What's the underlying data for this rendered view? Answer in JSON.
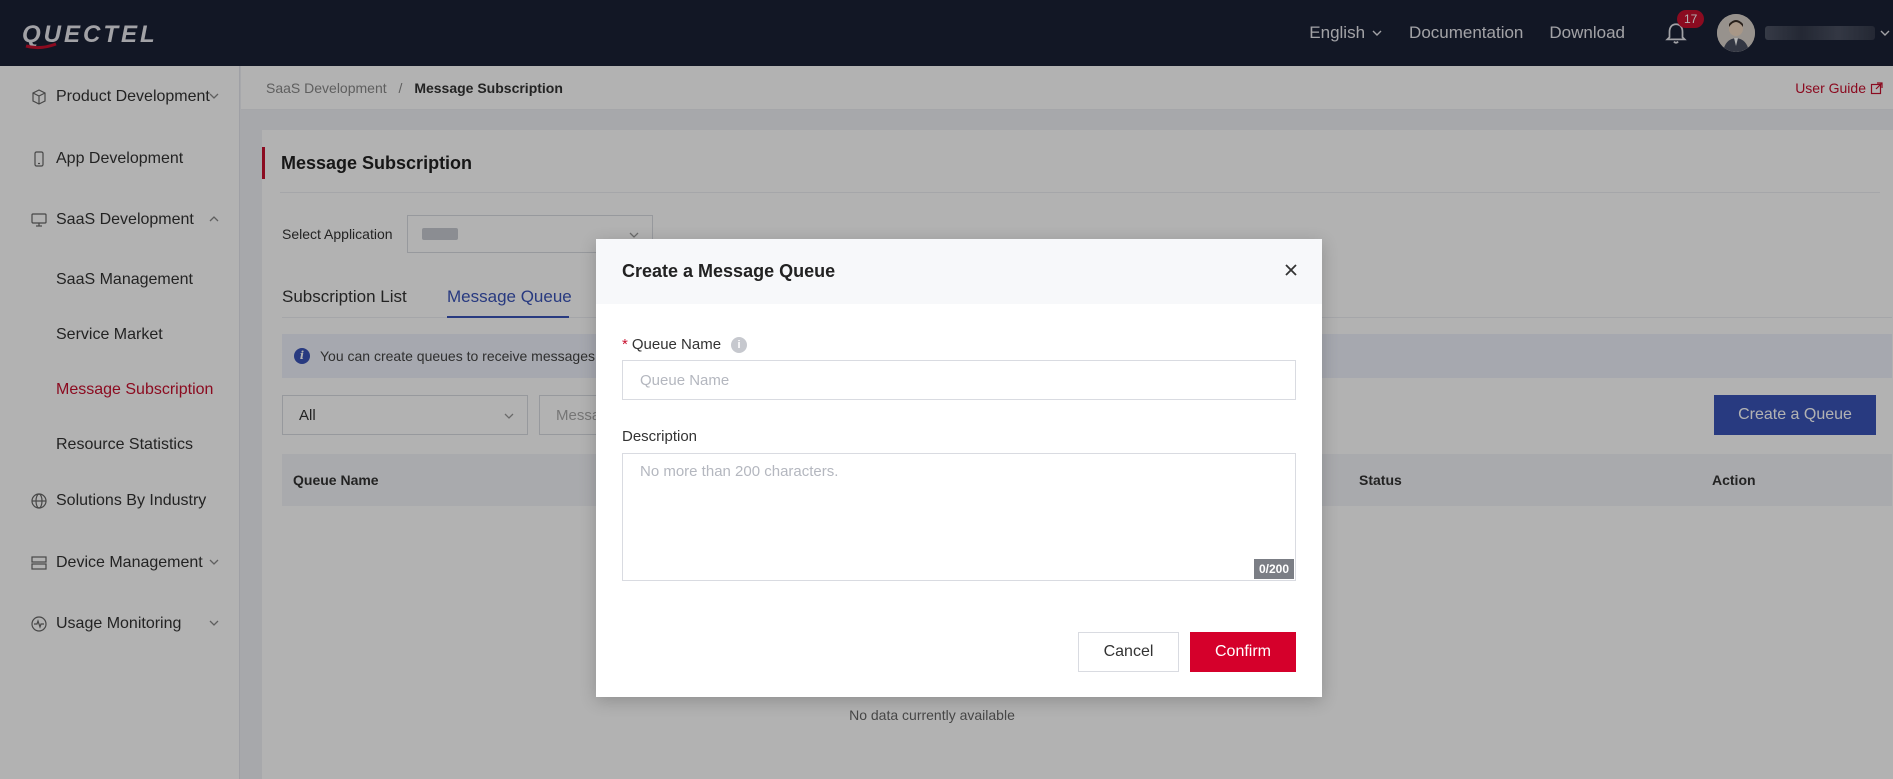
{
  "header": {
    "logo_text": "QUECTEL",
    "language": "English",
    "documentation": "Documentation",
    "download": "Download",
    "notification_count": "17"
  },
  "sidebar": {
    "items": [
      {
        "label": "Product Development",
        "icon": "cube-icon"
      },
      {
        "label": "App Development",
        "icon": "phone-icon"
      },
      {
        "label": "SaaS Development",
        "icon": "monitor-icon"
      },
      {
        "label": "Solutions By Industry",
        "icon": "globe-icon"
      },
      {
        "label": "Device Management",
        "icon": "server-icon"
      },
      {
        "label": "Usage Monitoring",
        "icon": "pulse-icon"
      }
    ],
    "sub_items": [
      "SaaS Management",
      "Service Market",
      "Message Subscription",
      "Resource Statistics"
    ]
  },
  "breadcrumb": {
    "parent": "SaaS Development",
    "separator": "/",
    "current": "Message Subscription",
    "user_guide": "User Guide"
  },
  "main": {
    "title": "Message Subscription",
    "select_application_label": "Select Application",
    "tabs": [
      "Subscription List",
      "Message Queue"
    ],
    "info_text": "You can create queues to receive messages",
    "filter_all": "All",
    "filter_search_placeholder": "Messa",
    "create_button": "Create a Queue",
    "columns": [
      "Queue Name",
      "Status",
      "Action"
    ],
    "no_data": "No data currently available"
  },
  "modal": {
    "title": "Create a Message Queue",
    "queue_name_label": "Queue Name",
    "queue_name_required": "*",
    "queue_name_placeholder": "Queue Name",
    "description_label": "Description",
    "description_placeholder": "No more than 200 characters.",
    "counter": "0/200",
    "cancel": "Cancel",
    "confirm": "Confirm"
  },
  "colors": {
    "brand_red": "#c8102e",
    "confirm_red": "#d5002b",
    "accent_blue": "#3a53b8",
    "topbar": "#1b2136"
  }
}
